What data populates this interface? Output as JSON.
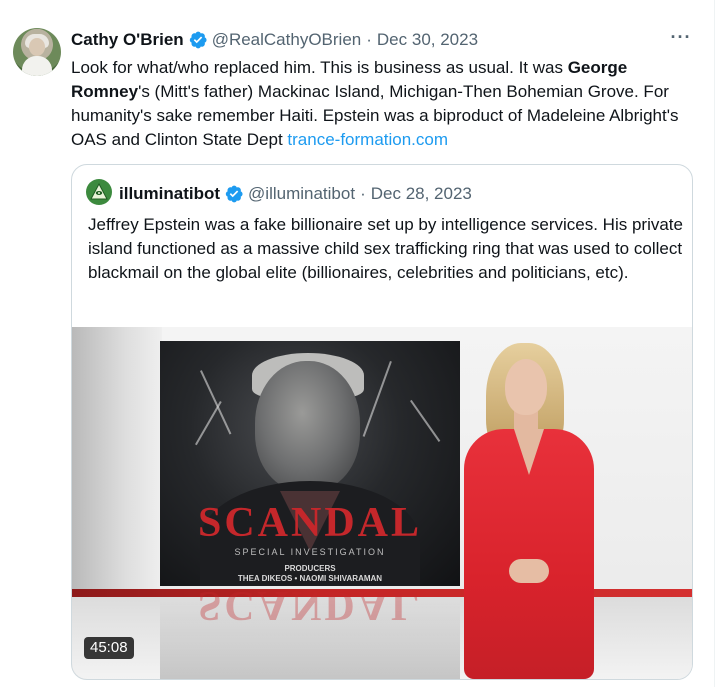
{
  "tweet": {
    "author_name": "Cathy O'Brien",
    "handle": "@RealCathyOBrien",
    "separator": "·",
    "date": "Dec 30, 2023",
    "more_label": "···",
    "text_part1": "Look for what/who replaced him. This is business as usual. It was ",
    "text_bold": "George Romney",
    "text_part2": "'s (Mitt's father) Mackinac Island, Michigan-Then Bohemian Grove. For humanity's sake remember Haiti. Epstein was a biproduct of Madeleine Albright's OAS and Clinton State Dept ",
    "link_text": "trance-formation.com"
  },
  "quote": {
    "author_name": "illuminatibot",
    "handle": "@illuminatibot",
    "separator": "·",
    "date": "Dec 28, 2023",
    "text": "Jeffrey Epstein was a fake billionaire set up by intelligence services. His private island functioned as a massive child sex trafficking ring that was used to collect blackmail on the global elite (billionaires, celebrities and politicians, etc).",
    "media": {
      "poster_title": "SCANDAL",
      "poster_subtitle": "SPECIAL INVESTIGATION",
      "producers_label": "PRODUCERS",
      "producers_names": "THEA DIKEOS • NAOMI SHIVARAMAN",
      "duration": "45:08"
    }
  },
  "colors": {
    "verified": "#1d9bf0",
    "link": "#1d9bf0",
    "secondary_text": "#536471",
    "border": "#cfd9de"
  }
}
